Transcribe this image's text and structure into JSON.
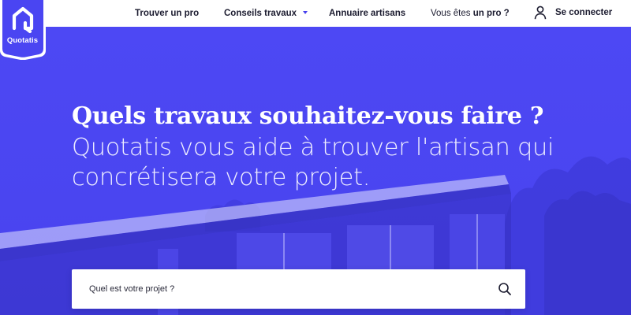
{
  "brand": {
    "name": "Quotatis",
    "accent_color": "#4a45f2",
    "logo_icon": "house-logo-icon"
  },
  "nav": {
    "find_pro": "Trouver un pro",
    "advice": "Conseils travaux",
    "directory": "Annuaire artisans",
    "pro_prefix": "Vous êtes",
    "pro_bold": "un pro ?",
    "login": "Se connecter",
    "login_icon": "user-icon",
    "advice_icon": "chevron-down-icon"
  },
  "hero": {
    "title": "Quels travaux souhaitez-vous faire ?",
    "subtitle": "Quotatis vous aide à trouver l'artisan qui concrétisera votre projet.",
    "background": "house-photo-blue-overlay"
  },
  "search": {
    "placeholder": "Quel est votre projet ?",
    "value": "",
    "icon": "search-icon"
  }
}
